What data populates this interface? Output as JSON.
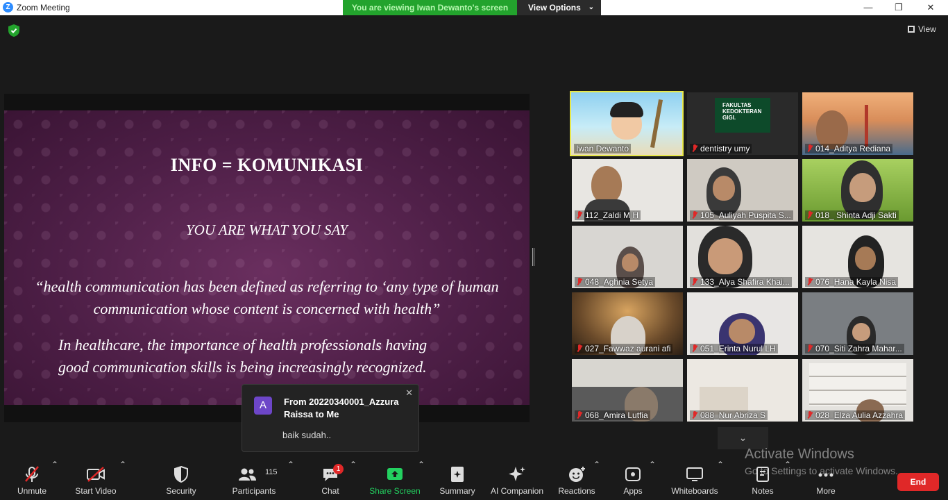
{
  "window": {
    "title": "Zoom Meeting",
    "viewing_banner": "You are viewing Iwan Dewanto's screen",
    "view_options": "View Options",
    "view_label": "View"
  },
  "slide": {
    "title": "INFO = KOMUNIKASI",
    "subtitle": "YOU ARE WHAT YOU SAY",
    "quote": "“health communication has been defined as referring to ‘any type of human communication whose content is concerned with health”",
    "body_line1": "In healthcare, the importance of health professionals having",
    "body_line2": "good communication skills is being increasingly recognized."
  },
  "participants": [
    {
      "name": "Iwan Dewanto",
      "muted": false,
      "active": true
    },
    {
      "name": "dentistry umy",
      "muted": true,
      "logo_text": "FAKULTAS KEDOKTERAN GIGI."
    },
    {
      "name": "014_Aditya Rediana",
      "muted": true
    },
    {
      "name": "112_Zaldi M H",
      "muted": true
    },
    {
      "name": "105_Auliyah Puspita S...",
      "muted": true
    },
    {
      "name": "018_ Shinta Adji Sakti",
      "muted": true
    },
    {
      "name": "048_Aghnia Setya",
      "muted": true
    },
    {
      "name": "133_Alya Shafira Khai...",
      "muted": true
    },
    {
      "name": "076_Hana Kayla Nisa",
      "muted": true
    },
    {
      "name": "027_Fawwaz aurani afi",
      "muted": true
    },
    {
      "name": "051_Erinta Nurul LH",
      "muted": true
    },
    {
      "name": "070_Siti Zahra Mahar...",
      "muted": true
    },
    {
      "name": "068_Amira Lutfia",
      "muted": true
    },
    {
      "name": "088_Nur Abriza S",
      "muted": true
    },
    {
      "name": "028_Elza Aulia Azzahra",
      "muted": true
    }
  ],
  "chat_popup": {
    "avatar_letter": "A",
    "from": "From 20220340001_Azzura Raissa to Me",
    "message": "baik sudah.."
  },
  "watermark": {
    "line1": "Activate Windows",
    "line2": "Go to Settings to activate Windows."
  },
  "toolbar": {
    "unmute": "Unmute",
    "start_video": "Start Video",
    "security": "Security",
    "participants": "Participants",
    "participants_count": "115",
    "chat": "Chat",
    "chat_badge": "1",
    "share_screen": "Share Screen",
    "summary": "Summary",
    "ai_companion": "AI Companion",
    "reactions": "Reactions",
    "apps": "Apps",
    "whiteboards": "Whiteboards",
    "notes": "Notes",
    "more": "More",
    "end": "End"
  },
  "colors": {
    "share_green": "#23a32d",
    "end_red": "#e02828",
    "active_speaker": "#e8e84a",
    "slide_purple": "#4e1f47"
  }
}
